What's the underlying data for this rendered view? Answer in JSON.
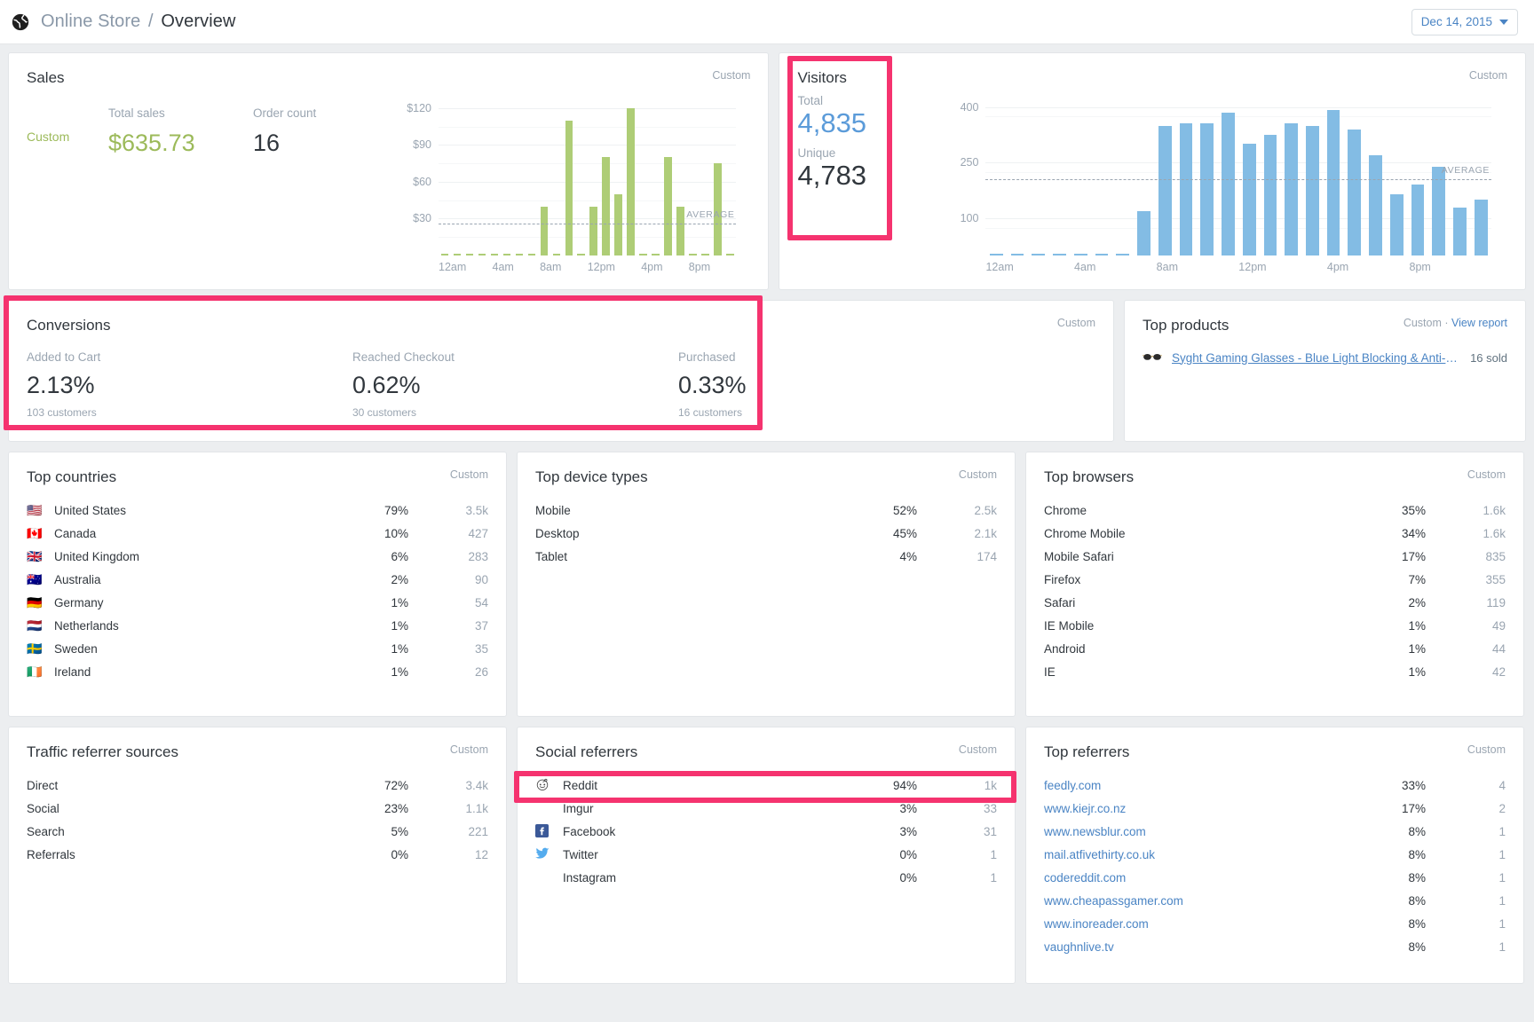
{
  "header": {
    "globe_icon": "globe-icon",
    "breadcrumb_store": "Online Store",
    "breadcrumb_separator": "/",
    "breadcrumb_page": "Overview",
    "date_label": "Dec 14, 2015",
    "date_caret_icon": "chevron-down-icon"
  },
  "sales": {
    "title": "Sales",
    "meta": "Custom",
    "period_label": "Custom",
    "total_sales_label": "Total sales",
    "total_sales_value": "$635.73",
    "order_count_label": "Order count",
    "order_count_value": "16"
  },
  "visitors": {
    "title": "Visitors",
    "meta": "Custom",
    "total_label": "Total",
    "total_value": "4,835",
    "unique_label": "Unique",
    "unique_value": "4,783"
  },
  "conversions": {
    "title": "Conversions",
    "meta": "Custom",
    "items": [
      {
        "label": "Added to Cart",
        "value": "2.13%",
        "sub": "103 customers"
      },
      {
        "label": "Reached Checkout",
        "value": "0.62%",
        "sub": "30 customers"
      },
      {
        "label": "Purchased",
        "value": "0.33%",
        "sub": "16 customers"
      }
    ]
  },
  "top_products": {
    "title": "Top products",
    "meta_custom": "Custom ·",
    "meta_link": "View report",
    "thumb_icon": "glasses-icon",
    "product_name": "Syght Gaming Glasses - Blue Light Blocking & Anti-Fati...",
    "product_sold": "16 sold"
  },
  "top_countries": {
    "title": "Top countries",
    "meta": "Custom",
    "rows": [
      {
        "flag": "🇺🇸",
        "name": "United States",
        "pct": "79%",
        "value": "3.5k"
      },
      {
        "flag": "🇨🇦",
        "name": "Canada",
        "pct": "10%",
        "value": "427"
      },
      {
        "flag": "🇬🇧",
        "name": "United Kingdom",
        "pct": "6%",
        "value": "283"
      },
      {
        "flag": "🇦🇺",
        "name": "Australia",
        "pct": "2%",
        "value": "90"
      },
      {
        "flag": "🇩🇪",
        "name": "Germany",
        "pct": "1%",
        "value": "54"
      },
      {
        "flag": "🇳🇱",
        "name": "Netherlands",
        "pct": "1%",
        "value": "37"
      },
      {
        "flag": "🇸🇪",
        "name": "Sweden",
        "pct": "1%",
        "value": "35"
      },
      {
        "flag": "🇮🇪",
        "name": "Ireland",
        "pct": "1%",
        "value": "26"
      }
    ]
  },
  "top_device_types": {
    "title": "Top device types",
    "meta": "Custom",
    "rows": [
      {
        "name": "Mobile",
        "pct": "52%",
        "value": "2.5k"
      },
      {
        "name": "Desktop",
        "pct": "45%",
        "value": "2.1k"
      },
      {
        "name": "Tablet",
        "pct": "4%",
        "value": "174"
      }
    ]
  },
  "top_browsers": {
    "title": "Top browsers",
    "meta": "Custom",
    "rows": [
      {
        "name": "Chrome",
        "pct": "35%",
        "value": "1.6k"
      },
      {
        "name": "Chrome Mobile",
        "pct": "34%",
        "value": "1.6k"
      },
      {
        "name": "Mobile Safari",
        "pct": "17%",
        "value": "835"
      },
      {
        "name": "Firefox",
        "pct": "7%",
        "value": "355"
      },
      {
        "name": "Safari",
        "pct": "2%",
        "value": "119"
      },
      {
        "name": "IE Mobile",
        "pct": "1%",
        "value": "49"
      },
      {
        "name": "Android",
        "pct": "1%",
        "value": "44"
      },
      {
        "name": "IE",
        "pct": "1%",
        "value": "42"
      }
    ]
  },
  "traffic_referrer_sources": {
    "title": "Traffic referrer sources",
    "meta": "Custom",
    "rows": [
      {
        "name": "Direct",
        "pct": "72%",
        "value": "3.4k"
      },
      {
        "name": "Social",
        "pct": "23%",
        "value": "1.1k"
      },
      {
        "name": "Search",
        "pct": "5%",
        "value": "221"
      },
      {
        "name": "Referrals",
        "pct": "0%",
        "value": "12"
      }
    ]
  },
  "social_referrers": {
    "title": "Social referrers",
    "meta": "Custom",
    "rows": [
      {
        "icon": "reddit-icon",
        "name": "Reddit",
        "pct": "94%",
        "value": "1k"
      },
      {
        "icon": "",
        "name": "Imgur",
        "pct": "3%",
        "value": "33"
      },
      {
        "icon": "facebook-icon",
        "name": "Facebook",
        "pct": "3%",
        "value": "31"
      },
      {
        "icon": "twitter-icon",
        "name": "Twitter",
        "pct": "0%",
        "value": "1"
      },
      {
        "icon": "",
        "name": "Instagram",
        "pct": "0%",
        "value": "1"
      }
    ]
  },
  "top_referrers": {
    "title": "Top referrers",
    "meta": "Custom",
    "rows": [
      {
        "name": "feedly.com",
        "pct": "33%",
        "value": "4"
      },
      {
        "name": "www.kiejr.co.nz",
        "pct": "17%",
        "value": "2"
      },
      {
        "name": "www.newsblur.com",
        "pct": "8%",
        "value": "1"
      },
      {
        "name": "mail.atfivethirty.co.uk",
        "pct": "8%",
        "value": "1"
      },
      {
        "name": "codereddit.com",
        "pct": "8%",
        "value": "1"
      },
      {
        "name": "www.cheapassgamer.com",
        "pct": "8%",
        "value": "1"
      },
      {
        "name": "www.inoreader.com",
        "pct": "8%",
        "value": "1"
      },
      {
        "name": "vaughnlive.tv",
        "pct": "8%",
        "value": "1"
      }
    ]
  },
  "colors": {
    "highlight": "#f5336f",
    "sales_green": "#9cba5a",
    "sales_bar": "#aecd76",
    "visitors_blue": "#5b9bd9",
    "visitors_bar": "#83bce4",
    "link": "#4a84c4",
    "muted": "#9aa5b1",
    "page_bg": "#eceef0"
  },
  "chart_data": [
    {
      "type": "bar",
      "title": "Sales",
      "xlabel": "",
      "ylabel": "",
      "ylim": [
        0,
        130
      ],
      "yticks": [
        "$30",
        "$60",
        "$90",
        "$120"
      ],
      "ytick_values": [
        30,
        60,
        90,
        120
      ],
      "average_line": 26,
      "average_label": "AVERAGE",
      "grid": true,
      "categories": [
        "12am",
        "1am",
        "2am",
        "3am",
        "4am",
        "5am",
        "6am",
        "7am",
        "8am",
        "9am",
        "10am",
        "11am",
        "12pm",
        "1pm",
        "2pm",
        "3pm",
        "4pm",
        "5pm",
        "6pm",
        "7pm",
        "8pm",
        "9pm",
        "10pm",
        "11pm"
      ],
      "tick_labels": [
        "12am",
        "4am",
        "8am",
        "12pm",
        "4pm",
        "8pm"
      ],
      "values": [
        1,
        1,
        1,
        1,
        1,
        1,
        1,
        1,
        40,
        1,
        110,
        1,
        40,
        80,
        50,
        120,
        1,
        1,
        80,
        40,
        1,
        1,
        75,
        1
      ]
    },
    {
      "type": "bar",
      "title": "Visitors",
      "xlabel": "",
      "ylabel": "",
      "ylim": [
        0,
        430
      ],
      "yticks": [
        "100",
        "250",
        "400"
      ],
      "ytick_values": [
        100,
        250,
        400
      ],
      "average_line": 205,
      "average_label": "AVERAGE",
      "grid": true,
      "categories": [
        "12am",
        "1am",
        "2am",
        "3am",
        "4am",
        "5am",
        "6am",
        "7am",
        "8am",
        "9am",
        "10am",
        "11am",
        "12pm",
        "1pm",
        "2pm",
        "3pm",
        "4pm",
        "5pm",
        "6pm",
        "7pm",
        "8pm",
        "9pm",
        "10pm",
        "11pm"
      ],
      "tick_labels": [
        "12am",
        "4am",
        "8am",
        "12pm",
        "4pm",
        "8pm"
      ],
      "values": [
        4,
        4,
        4,
        4,
        4,
        4,
        4,
        120,
        350,
        357,
        357,
        385,
        300,
        325,
        357,
        350,
        393,
        340,
        270,
        165,
        190,
        240,
        130,
        150
      ]
    }
  ]
}
